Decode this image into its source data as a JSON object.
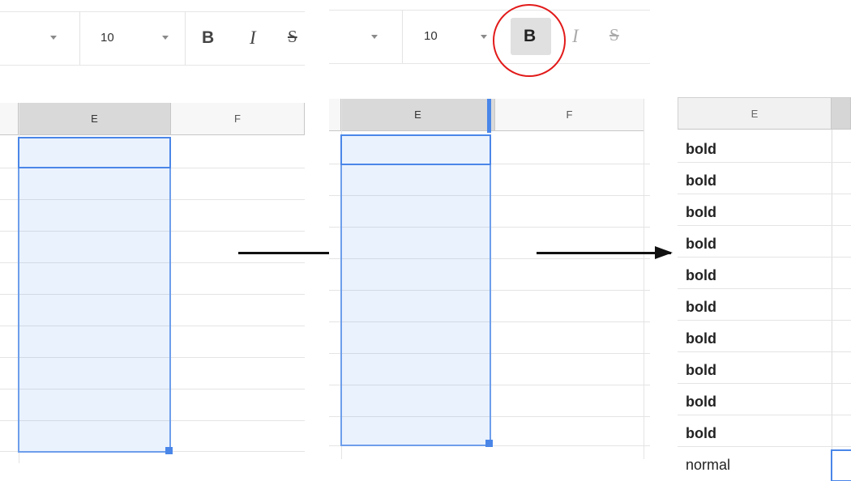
{
  "toolbar_before": {
    "font_size": "10",
    "bold_label": "B",
    "italic_label": "I",
    "strike_label": "S"
  },
  "toolbar_after": {
    "font_size": "10",
    "bold_label": "B",
    "italic_label": "I",
    "strike_label": "S"
  },
  "grid_before": {
    "columns": [
      "E",
      "F"
    ]
  },
  "grid_selected": {
    "columns": [
      "E",
      "F"
    ]
  },
  "grid_result": {
    "columns": [
      "E"
    ],
    "rows": [
      "bold",
      "bold",
      "bold",
      "bold",
      "bold",
      "bold",
      "bold",
      "bold",
      "bold",
      "bold",
      "normal"
    ]
  },
  "colors": {
    "selection_border": "#6d9eeb",
    "highlight_circle": "#e21a1a",
    "arrow": "#111111"
  }
}
